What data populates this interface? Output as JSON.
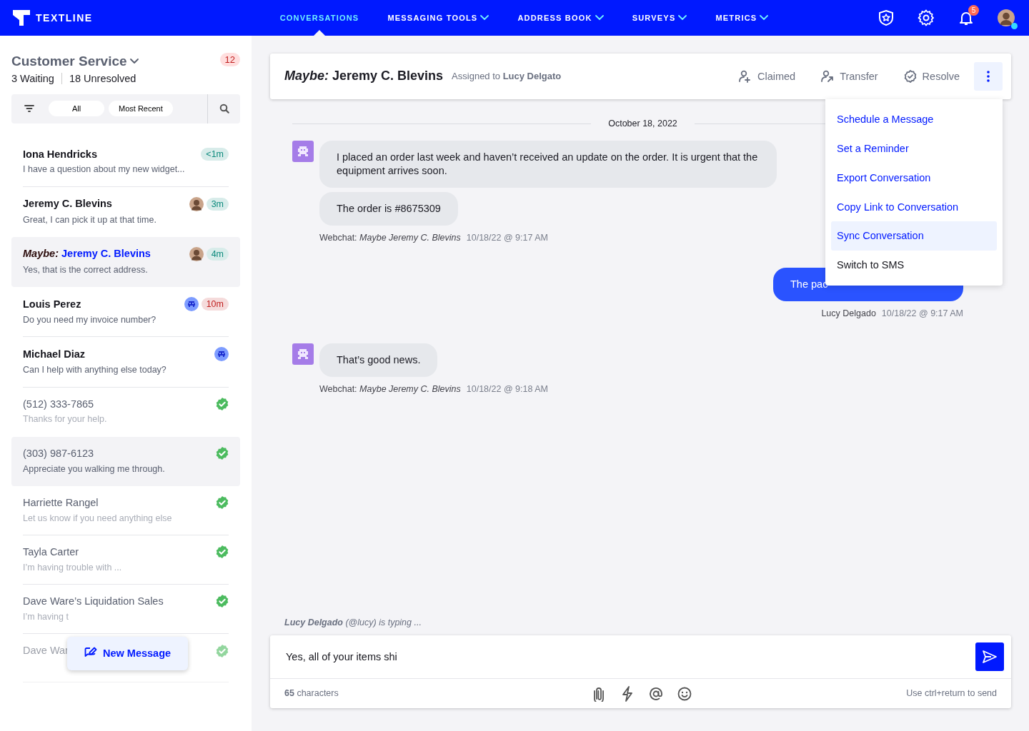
{
  "nav": {
    "brand": "TEXTLINE",
    "items": [
      {
        "label": "CONVERSATIONS",
        "selected": true,
        "dropdown": false
      },
      {
        "label": "MESSAGING TOOLS",
        "selected": false,
        "dropdown": true
      },
      {
        "label": "ADDRESS BOOK",
        "selected": false,
        "dropdown": true
      },
      {
        "label": "SURVEYS",
        "selected": false,
        "dropdown": true
      },
      {
        "label": "METRICS",
        "selected": false,
        "dropdown": true
      }
    ],
    "notifications": "5",
    "online": true
  },
  "sidebar": {
    "title": "Customer Service",
    "count": "12",
    "waiting": "3 Waiting",
    "unresolved": "18 Unresolved",
    "filters": [
      "All",
      "Most Recent"
    ],
    "conversations": [
      {
        "name": "Iona Hendricks",
        "preview": "I have a question about my new widget...",
        "time": "<1m",
        "color": "#0d8a7d",
        "kind": "plain",
        "resolved": false,
        "selected": false,
        "hovered": false,
        "faded": false
      },
      {
        "name": "Jeremy C. Blevins",
        "preview": "Great, I can pick it up at that time.",
        "time": "3m",
        "color": "#0d8a7d",
        "kind": "photo",
        "resolved": false,
        "selected": false,
        "hovered": false,
        "faded": false
      },
      {
        "prefix": "Maybe:",
        "name": "Jeremy C. Blevins",
        "preview": "Yes, that is the correct address.",
        "time": "4m",
        "color": "#0d8a7d",
        "kind": "photo",
        "resolved": false,
        "selected": true,
        "hovered": false,
        "faded": false
      },
      {
        "name": "Louis Perez",
        "preview": "Do you need my invoice number?",
        "time": "10m",
        "color": "#c01f1f",
        "kind": "bot",
        "resolved": false,
        "selected": false,
        "hovered": false,
        "faded": false
      },
      {
        "name": "Michael Diaz",
        "preview": "Can I help with anything else today?",
        "kind": "bot",
        "resolved": false,
        "selected": false,
        "hovered": false,
        "faded": false
      },
      {
        "name": "(512) 333-7865",
        "preview": "Thanks for your help.",
        "kind": "check",
        "resolved": true,
        "selected": false,
        "hovered": false,
        "faded": false
      },
      {
        "name": "(303) 987-6123",
        "preview": "Appreciate you walking me through.",
        "kind": "check",
        "resolved": true,
        "selected": false,
        "hovered": true,
        "faded": false
      },
      {
        "name": "Harriette Rangel",
        "preview": "Let us know if you need anything else",
        "kind": "check",
        "resolved": true,
        "selected": false,
        "hovered": false,
        "faded": false
      },
      {
        "name": "Tayla Carter",
        "preview": "I’m having trouble with ...",
        "kind": "check",
        "resolved": true,
        "selected": false,
        "hovered": false,
        "faded": false
      },
      {
        "name": "Dave Ware’s Liquidation Sales",
        "preview": "I’m having t",
        "kind": "check",
        "resolved": true,
        "selected": false,
        "hovered": false,
        "faded": false
      },
      {
        "name": "Dave War",
        "kind": "check",
        "resolved": true,
        "selected": false,
        "hovered": false,
        "faded": true
      }
    ],
    "new_message": "New Message"
  },
  "conversation": {
    "title": "*Maybe:* Jeremy C. Blevins",
    "assigned_label": "Assigned to",
    "assignee": "Lucy Delgato",
    "actions": [
      {
        "label": "Claimed",
        "kind": "claim"
      },
      {
        "label": "Transfer",
        "kind": "transfer"
      },
      {
        "label": "Resolve",
        "kind": "resolve"
      }
    ],
    "more_open": true,
    "menu": [
      {
        "label": "Schedule a Message",
        "kind": "action",
        "highlighted": false
      },
      {
        "label": "Set a Reminder",
        "kind": "action",
        "highlighted": false
      },
      {
        "label": "Export Conversation",
        "kind": "action",
        "highlighted": false
      },
      {
        "label": "Copy Link to Conversation",
        "kind": "action",
        "highlighted": false
      },
      {
        "label": "Sync Conversation",
        "kind": "action",
        "highlighted": true
      },
      {
        "label": "Switch to SMS",
        "kind": "option",
        "highlighted": false
      }
    ],
    "thread": [
      {
        "kind": "date",
        "text": "October 18, 2022"
      },
      {
        "kind": "inbound",
        "bubbles": [
          "I placed an order last week and haven’t received an update on the order. It is urgent that the equipment arrives soon.",
          "The order is #8675309"
        ],
        "channel": "Webchat:",
        "sender": "Maybe Jeremy C. Blevins",
        "time": "10/18/22 @ 9:17 AM"
      },
      {
        "kind": "outbound",
        "bubbles": [
          "The pac"
        ],
        "sender": "Lucy Delgado",
        "time": "10/18/22 @ 9:17 AM"
      },
      {
        "kind": "inbound",
        "bubbles": [
          "That’s good news."
        ],
        "channel": "Webchat:",
        "sender": "Maybe Jeremy C. Blevins",
        "time": "10/18/22 @ 9:18 AM"
      }
    ],
    "typing": "**Lucy Delgado** (@lucy) is typing ...",
    "composer": {
      "value": "Yes, all of your items shi",
      "counter": "**65** characters",
      "hint": "Use ctrl+return to send"
    }
  }
}
